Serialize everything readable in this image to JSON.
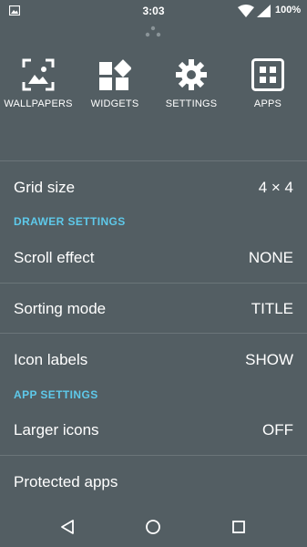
{
  "status_bar": {
    "time": "3:03",
    "battery": "100%",
    "icons": [
      "gallery-notification-icon",
      "wifi-icon",
      "cell-signal-icon"
    ]
  },
  "shortcuts": [
    {
      "label": "WALLPAPERS",
      "icon": "wallpapers-icon"
    },
    {
      "label": "WIDGETS",
      "icon": "widgets-icon"
    },
    {
      "label": "SETTINGS",
      "icon": "settings-gear-icon"
    },
    {
      "label": "APPS",
      "icon": "apps-grid-icon"
    }
  ],
  "settings": {
    "grid_size": {
      "label": "Grid size",
      "value": "4 × 4"
    },
    "drawer_header": "DRAWER SETTINGS",
    "scroll_effect": {
      "label": "Scroll effect",
      "value": "NONE"
    },
    "sorting_mode": {
      "label": "Sorting mode",
      "value": "TITLE"
    },
    "icon_labels": {
      "label": "Icon labels",
      "value": "SHOW"
    },
    "app_header": "APP SETTINGS",
    "larger_icons": {
      "label": "Larger icons",
      "value": "OFF"
    },
    "protected_apps": {
      "label": "Protected apps"
    }
  },
  "nav_bar": [
    "back-icon",
    "home-icon",
    "recents-icon"
  ],
  "colors": {
    "background": "#535e63",
    "section_header": "#5ec9ea",
    "divider": "#6b7579",
    "text": "#ffffff"
  }
}
